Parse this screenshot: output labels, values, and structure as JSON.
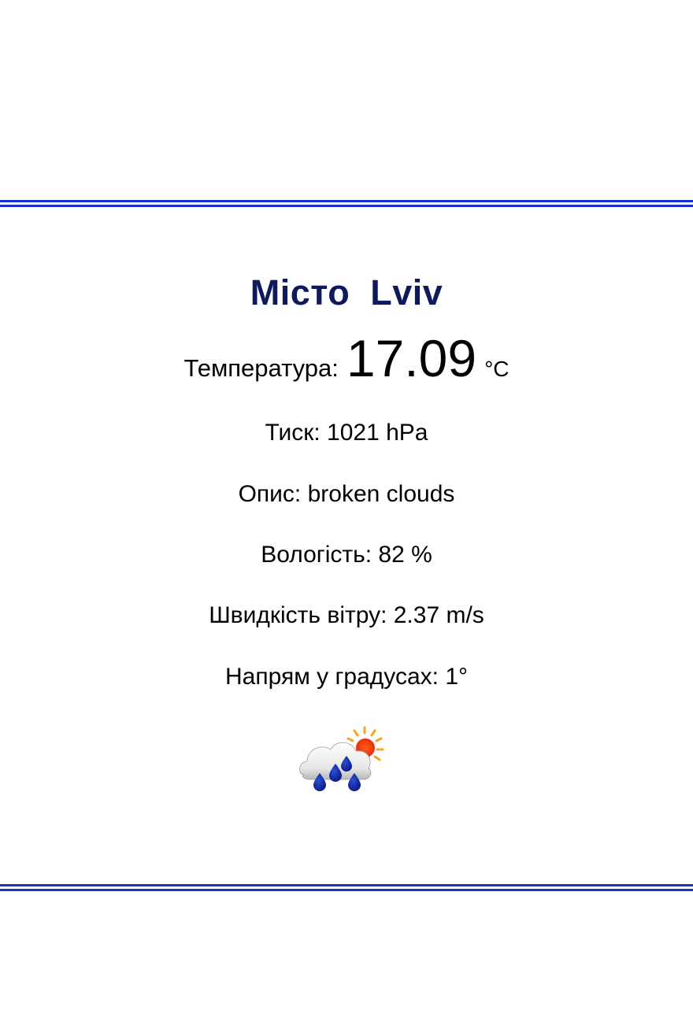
{
  "weather": {
    "city_label": "Місто  Lviv",
    "temperature_label": "Температура:",
    "temperature_value": "17.09",
    "temperature_unit": "°C",
    "pressure": "Тиск: 1021 hPa",
    "description": "Опис: broken clouds",
    "humidity": "Вологість: 82 %",
    "wind_speed": "Швидкість вітру: 2.37 m/s",
    "wind_direction": "Напрям у градусах: 1°",
    "icon": "rain-cloud-sun-icon"
  },
  "colors": {
    "accent_rule": "#1933c8",
    "city_text": "#0f1a5c"
  }
}
